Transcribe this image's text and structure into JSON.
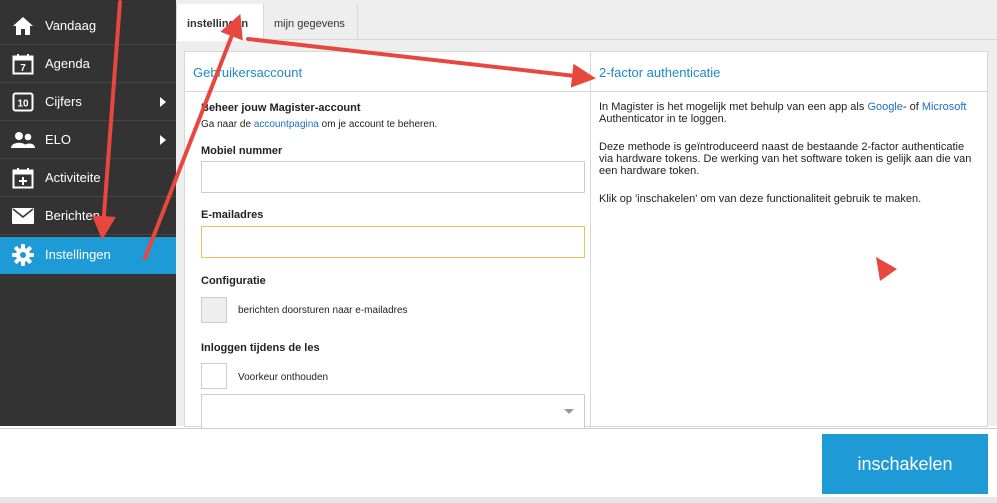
{
  "sidebar": {
    "items": [
      {
        "label": "Vandaag",
        "icon": "home-icon",
        "has_submenu": false,
        "active": false
      },
      {
        "label": "Agenda",
        "icon": "calendar-icon",
        "has_submenu": false,
        "active": false
      },
      {
        "label": "Cijfers",
        "icon": "grades-icon",
        "has_submenu": true,
        "active": false
      },
      {
        "label": "ELO",
        "icon": "users-icon",
        "has_submenu": true,
        "active": false
      },
      {
        "label": "Activiteite",
        "icon": "calendar-plus-icon",
        "has_submenu": false,
        "active": false
      },
      {
        "label": "Berichten",
        "icon": "envelope-icon",
        "has_submenu": false,
        "active": false
      },
      {
        "label": "Instellingen",
        "icon": "gear-icon",
        "has_submenu": false,
        "active": true
      }
    ],
    "agenda_icon_day": "7",
    "grades_icon_text": "10"
  },
  "tabs": [
    {
      "label": "instellingen",
      "active": true
    },
    {
      "label": "mijn gegevens",
      "active": false
    }
  ],
  "account": {
    "title": "Gebruikersaccount",
    "manage_heading": "Beheer jouw Magister-account",
    "manage_text_pre": "Ga naar de ",
    "manage_link": "accountpagina",
    "manage_text_post": " om je account te beheren.",
    "mobile_label": "Mobiel nummer",
    "mobile_value": "",
    "email_label": "E-mailadres",
    "email_value": "",
    "config_heading": "Configuratie",
    "forward_label": "berichten doorsturen naar e-mailadres",
    "login_heading": "Inloggen tijdens de les",
    "remember_label": "Voorkeur onthouden",
    "select_value": ""
  },
  "twofactor": {
    "title": "2-factor authenticatie",
    "p1_pre": "In Magister is het mogelijk met behulp van een app als ",
    "p1_link1": "Google",
    "p1_mid": "- of ",
    "p1_link2": "Microsoft",
    "p1_post": " Authenticator in te loggen.",
    "p2": "Deze methode is geïntroduceerd naast de bestaande 2-factor authenticatie via hardware tokens. De werking van het software token is gelijk aan die van een hardware token.",
    "p3": "Klik op 'inschakelen' om van deze functionaliteit gebruik te maken."
  },
  "footer": {
    "enable_button": "inschakelen"
  },
  "colors": {
    "accent": "#1e9ad6",
    "sidebar_bg": "#333333",
    "annotation_arrow": "#e8473f",
    "link": "#1a6fc4"
  }
}
